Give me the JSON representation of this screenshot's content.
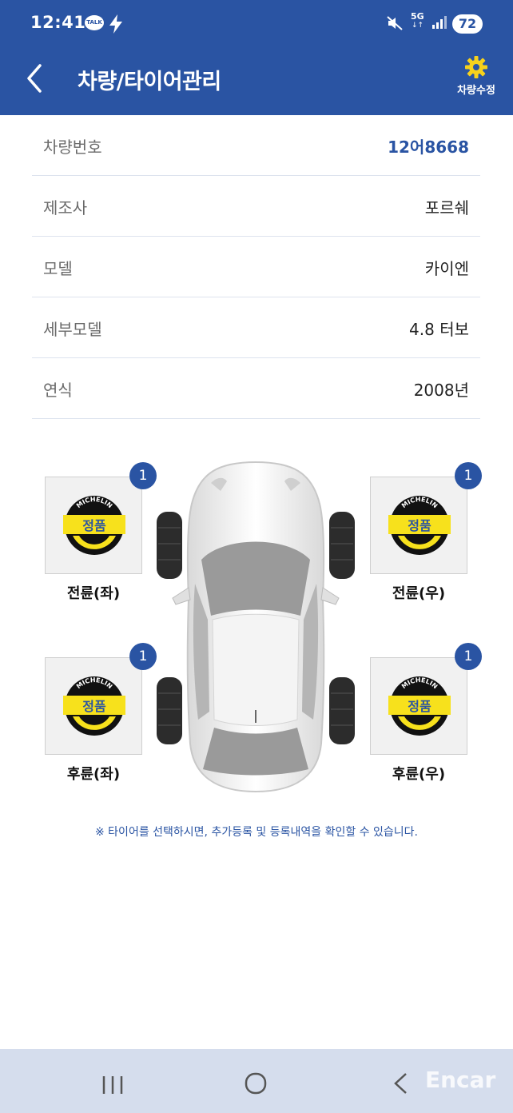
{
  "status_bar": {
    "time": "12:41",
    "talk_label": "TALK",
    "network": "5G",
    "network_arrows": "↓↑",
    "battery": "72"
  },
  "header": {
    "title": "차량/타이어관리",
    "edit_label": "차량수정",
    "background_color": "#2a54a3"
  },
  "vehicle_info": [
    {
      "label": "차량번호",
      "value": "12어8668"
    },
    {
      "label": "제조사",
      "value": "포르쉐"
    },
    {
      "label": "모델",
      "value": "카이엔"
    },
    {
      "label": "세부모델",
      "value": "4.8 터보"
    },
    {
      "label": "연식",
      "value": "2008년"
    }
  ],
  "tires": [
    {
      "position": "전륜(좌)",
      "count": "1",
      "brand": "MICHELIN",
      "tag": "정품"
    },
    {
      "position": "전륜(우)",
      "count": "1",
      "brand": "MICHELIN",
      "tag": "정품"
    },
    {
      "position": "후륜(좌)",
      "count": "1",
      "brand": "MICHELIN",
      "tag": "정품"
    },
    {
      "position": "후륜(우)",
      "count": "1",
      "brand": "MICHELIN",
      "tag": "정품"
    }
  ],
  "notice": "※ 타이어를 선택하시면, 추가등록 및 등록내역을 확인할 수 있습니다.",
  "watermark": "Encar",
  "icons": [
    "talk-icon",
    "bolt-icon",
    "mute-icon",
    "signal-icon",
    "back-arrow-icon",
    "gear-icon",
    "recent-apps-icon",
    "home-icon",
    "nav-back-icon"
  ],
  "colors": {
    "accent": "#2a54a3",
    "tag_yellow": "#f7e11c"
  }
}
